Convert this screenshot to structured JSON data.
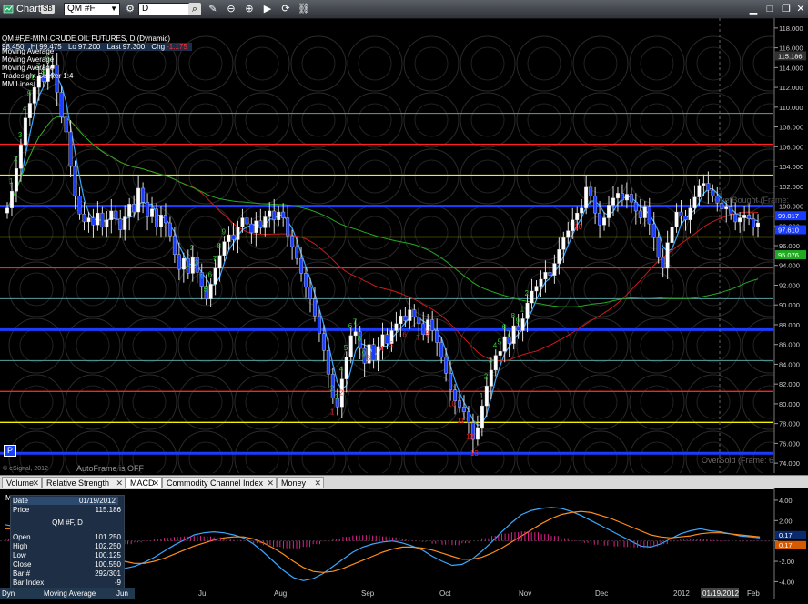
{
  "window": {
    "title": "Chart",
    "title_badge": "SB",
    "symbol": "QM #F",
    "interval": "D"
  },
  "chart_info": {
    "title": "QM #F,E-MINI CRUDE OIL FUTURES, D (Dynamic)",
    "quote": {
      "open": "98.450",
      "high_label": "Hi",
      "high": "99.475",
      "low_label": "Lo",
      "low": "97.200",
      "last_label": "Last",
      "last": "97.300",
      "chg_label": "Chg",
      "chg": "-1.175",
      "chg_color": "#ff3333"
    },
    "studies": [
      "Moving Average",
      "Moving Average",
      "Moving Average",
      "Tradesight Seeker 1:4",
      "MM Lines"
    ],
    "autoframe": "AutoFrame is OFF",
    "copyright": "© eSignal, 2012",
    "overbought": "OverBought (Frame:",
    "oversold": "OverSold (Frame: 6",
    "p_button": "P"
  },
  "chart_data": [
    {
      "type": "candlestick",
      "title": "QM #F,E-MINI CRUDE OIL FUTURES, D (Dynamic)",
      "ylim": [
        73.0,
        119.0
      ],
      "yticks": [
        "118.000",
        "116.000",
        "114.000",
        "112.000",
        "110.000",
        "108.000",
        "106.000",
        "104.000",
        "102.000",
        "100.000",
        "98.000",
        "96.000",
        "94.000",
        "92.000",
        "90.000",
        "88.000",
        "86.000",
        "84.000",
        "82.000",
        "80.000",
        "78.000",
        "76.000",
        "74.000"
      ],
      "x_labels": [
        "Jul",
        "Aug",
        "Sep",
        "Oct",
        "Nov",
        "Dec",
        "2012",
        "Feb"
      ],
      "cursor_label": "01/19/2012",
      "price_tags": [
        {
          "value": 115.186,
          "label": "115.186",
          "color": "#333333"
        },
        {
          "value": 99.017,
          "label": "99.017",
          "color": "#1a3cff"
        },
        {
          "value": 97.61,
          "label": "97.610",
          "color": "#1a3cff"
        },
        {
          "value": 95.076,
          "label": "95.076",
          "color": "#22aa22"
        }
      ],
      "mm_lines": [
        {
          "value": 109.375,
          "color": "#5aa0a0",
          "width": 1
        },
        {
          "value": 106.25,
          "color": "#ff2020",
          "width": 1.3
        },
        {
          "value": 103.125,
          "color": "#f0f000",
          "width": 1.3
        },
        {
          "value": 100.0,
          "color": "#1a3cff",
          "width": 3
        },
        {
          "value": 96.875,
          "color": "#f0f000",
          "width": 1.3
        },
        {
          "value": 93.75,
          "color": "#ff2020",
          "width": 1.3
        },
        {
          "value": 90.625,
          "color": "#5aa0a0",
          "width": 1
        },
        {
          "value": 87.5,
          "color": "#1a3cff",
          "width": 3
        },
        {
          "value": 84.375,
          "color": "#5aa0a0",
          "width": 1
        },
        {
          "value": 81.25,
          "color": "#ff2020",
          "width": 1.3
        },
        {
          "value": 78.125,
          "color": "#f0f000",
          "width": 1.3
        },
        {
          "value": 75.0,
          "color": "#1a3cff",
          "width": 3
        }
      ],
      "closes": [
        99.8,
        101.5,
        103.8,
        106.2,
        108.9,
        110.4,
        112.0,
        113.2,
        112.6,
        113.9,
        114.3,
        111.5,
        109.0,
        107.5,
        104.0,
        101.0,
        99.2,
        98.4,
        98.8,
        98.1,
        99.3,
        97.9,
        98.6,
        99.5,
        98.7,
        97.6,
        98.9,
        100.2,
        99.4,
        101.8,
        100.4,
        98.9,
        99.7,
        97.9,
        99.1,
        98.3,
        97.0,
        95.1,
        93.6,
        94.7,
        93.2,
        94.8,
        93.3,
        91.9,
        90.6,
        92.1,
        93.7,
        95.0,
        96.4,
        97.1,
        96.6,
        97.9,
        98.8,
        98.2,
        97.3,
        98.5,
        97.8,
        98.9,
        99.5,
        98.6,
        99.4,
        98.8,
        97.0,
        95.9,
        94.7,
        93.2,
        91.8,
        90.6,
        88.9,
        87.1,
        85.4,
        83.0,
        80.6,
        79.7,
        82.5,
        84.7,
        86.9,
        87.3,
        85.6,
        84.1,
        86.0,
        84.4,
        85.8,
        87.0,
        86.1,
        87.4,
        88.1,
        88.9,
        88.4,
        89.5,
        88.8,
        88.1,
        87.0,
        88.5,
        87.4,
        86.2,
        84.7,
        83.1,
        81.4,
        80.3,
        79.7,
        79.2,
        78.1,
        76.4,
        77.6,
        79.8,
        81.8,
        83.4,
        84.9,
        85.3,
        86.8,
        86.1,
        87.9,
        87.4,
        88.6,
        90.2,
        91.4,
        91.9,
        92.6,
        93.3,
        93.0,
        94.2,
        95.6,
        96.8,
        97.5,
        98.6,
        99.3,
        99.8,
        101.9,
        101.0,
        99.3,
        98.1,
        98.8,
        100.1,
        100.8,
        101.3,
        100.6,
        101.2,
        100.4,
        99.5,
        98.8,
        99.9,
        98.2,
        96.8,
        94.8,
        93.7,
        96.3,
        97.9,
        99.4,
        99.0,
        98.6,
        99.8,
        100.9,
        102.1,
        102.3,
        101.6,
        101.0,
        100.3,
        99.7,
        99.9,
        99.2,
        98.4,
        98.8,
        99.1,
        98.7,
        97.9,
        98.3
      ]
    },
    {
      "type": "line",
      "title": "MACD",
      "ylim": [
        -4.5,
        4.8
      ],
      "yticks": [
        "4.00",
        "2.00",
        "",
        "-2.00",
        "-4.00"
      ],
      "last_values": [
        {
          "label": "0.17",
          "color": "#0a2a6e"
        },
        {
          "label": "0.17",
          "color": "#d65a00"
        }
      ],
      "series": [
        {
          "color": "#3aa8ff",
          "values": [
            1.6,
            1.4,
            1.1,
            0.9,
            0.5,
            0.0,
            -0.5,
            -1.0,
            -1.5,
            -1.9,
            -2.3,
            -2.6,
            -2.7,
            -2.5,
            -2.1,
            -1.6,
            -1.0,
            -0.4,
            0.1,
            0.6,
            0.8,
            0.9,
            0.8,
            0.6,
            0.3,
            -0.3,
            -1.1,
            -2.0,
            -2.9,
            -3.6,
            -3.9,
            -3.7,
            -3.2,
            -2.5,
            -1.8,
            -1.1,
            -0.6,
            -0.3,
            -0.1,
            0.0,
            -0.2,
            -0.5,
            -0.9,
            -1.5,
            -2.0,
            -2.4,
            -2.3,
            -1.8,
            -1.0,
            -0.1,
            0.9,
            1.8,
            2.6,
            3.0,
            3.2,
            3.3,
            3.2,
            2.9,
            2.5,
            2.0,
            1.5,
            1.0,
            0.5,
            0.0,
            -0.5,
            -0.6,
            -0.3,
            0.2,
            0.7,
            1.0,
            1.2,
            1.0,
            0.9,
            0.7,
            0.5,
            0.4,
            0.3
          ]
        },
        {
          "color": "#ff8c1a",
          "values": [
            1.2,
            1.2,
            1.1,
            1.0,
            0.8,
            0.6,
            0.3,
            -0.1,
            -0.5,
            -0.9,
            -1.3,
            -1.7,
            -2.0,
            -2.2,
            -2.2,
            -2.0,
            -1.7,
            -1.3,
            -0.9,
            -0.5,
            -0.2,
            0.1,
            0.3,
            0.4,
            0.4,
            0.2,
            -0.2,
            -0.7,
            -1.3,
            -2.0,
            -2.6,
            -3.0,
            -3.1,
            -3.0,
            -2.7,
            -2.3,
            -1.9,
            -1.5,
            -1.1,
            -0.8,
            -0.6,
            -0.6,
            -0.7,
            -0.9,
            -1.2,
            -1.5,
            -1.8,
            -1.8,
            -1.6,
            -1.2,
            -0.7,
            -0.1,
            0.5,
            1.1,
            1.7,
            2.2,
            2.6,
            2.8,
            2.9,
            2.8,
            2.5,
            2.2,
            1.8,
            1.4,
            1.0,
            0.6,
            0.4,
            0.3,
            0.4,
            0.5,
            0.7,
            0.8,
            0.8,
            0.7,
            0.6,
            0.5,
            0.4
          ]
        },
        {
          "color": "#e0208a",
          "type": "histogram",
          "values": [
            0.4,
            0.2,
            0.0,
            -0.1,
            -0.3,
            -0.6,
            -0.8,
            -0.9,
            -1.0,
            -1.0,
            -1.0,
            -0.9,
            -0.7,
            -0.3,
            0.1,
            0.4,
            0.7,
            0.9,
            1.0,
            1.1,
            1.0,
            0.8,
            0.5,
            0.2,
            -0.1,
            -0.5,
            -0.9,
            -1.3,
            -1.6,
            -1.6,
            -1.3,
            -0.7,
            -0.1,
            0.5,
            0.9,
            1.2,
            1.3,
            1.2,
            1.0,
            0.8,
            0.4,
            0.1,
            -0.2,
            -0.6,
            -0.8,
            -0.9,
            -0.5,
            0.0,
            0.6,
            1.1,
            1.6,
            1.9,
            2.1,
            1.9,
            1.5,
            1.1,
            0.6,
            0.1,
            -0.4,
            -0.8,
            -1.0,
            -1.2,
            -1.3,
            -1.4,
            -1.5,
            -1.2,
            -0.7,
            -0.1,
            0.3,
            0.5,
            0.5,
            0.2,
            0.1,
            0.0,
            -0.1,
            -0.1,
            -0.1
          ]
        }
      ]
    }
  ],
  "tabs": [
    {
      "label": "Volume"
    },
    {
      "label": "Relative Strength Index"
    },
    {
      "label": "MACD"
    },
    {
      "label": "Commodity Channel Index (CCI)"
    },
    {
      "label": "Money Flow"
    }
  ],
  "macd_title": "MACD",
  "databox": {
    "symbol": "QM #F, D",
    "rows": [
      {
        "k": "Date",
        "v": "01/19/2012"
      },
      {
        "k": "Price",
        "v": "115.186"
      },
      {
        "k": "Open",
        "v": "101.250"
      },
      {
        "k": "High",
        "v": "102.250"
      },
      {
        "k": "Low",
        "v": "100.125"
      },
      {
        "k": "Close",
        "v": "100.550"
      },
      {
        "k": "Bar #",
        "v": "292/301"
      },
      {
        "k": "Bar Index",
        "v": "-9"
      }
    ]
  },
  "bottom_bar": {
    "left": "Dyn",
    "label": "Moving Average",
    "month": "Jun"
  },
  "seeker_counts": {
    "green": [
      "1",
      "2",
      "3",
      "4",
      "5",
      "6",
      "7",
      "8",
      "9",
      "1",
      "2",
      "3",
      "4",
      "5",
      "6",
      "7",
      "8",
      "9",
      "2",
      "3",
      "4",
      "5",
      "6",
      "7",
      "8",
      "9",
      "1",
      "2",
      "3",
      "4",
      "5",
      "6",
      "7",
      "8",
      "9",
      "1",
      "2"
    ],
    "red": [
      "1",
      "2",
      "3",
      "4",
      "5",
      "6",
      "7",
      "8",
      "10",
      "11",
      "12",
      "13",
      "10"
    ]
  }
}
